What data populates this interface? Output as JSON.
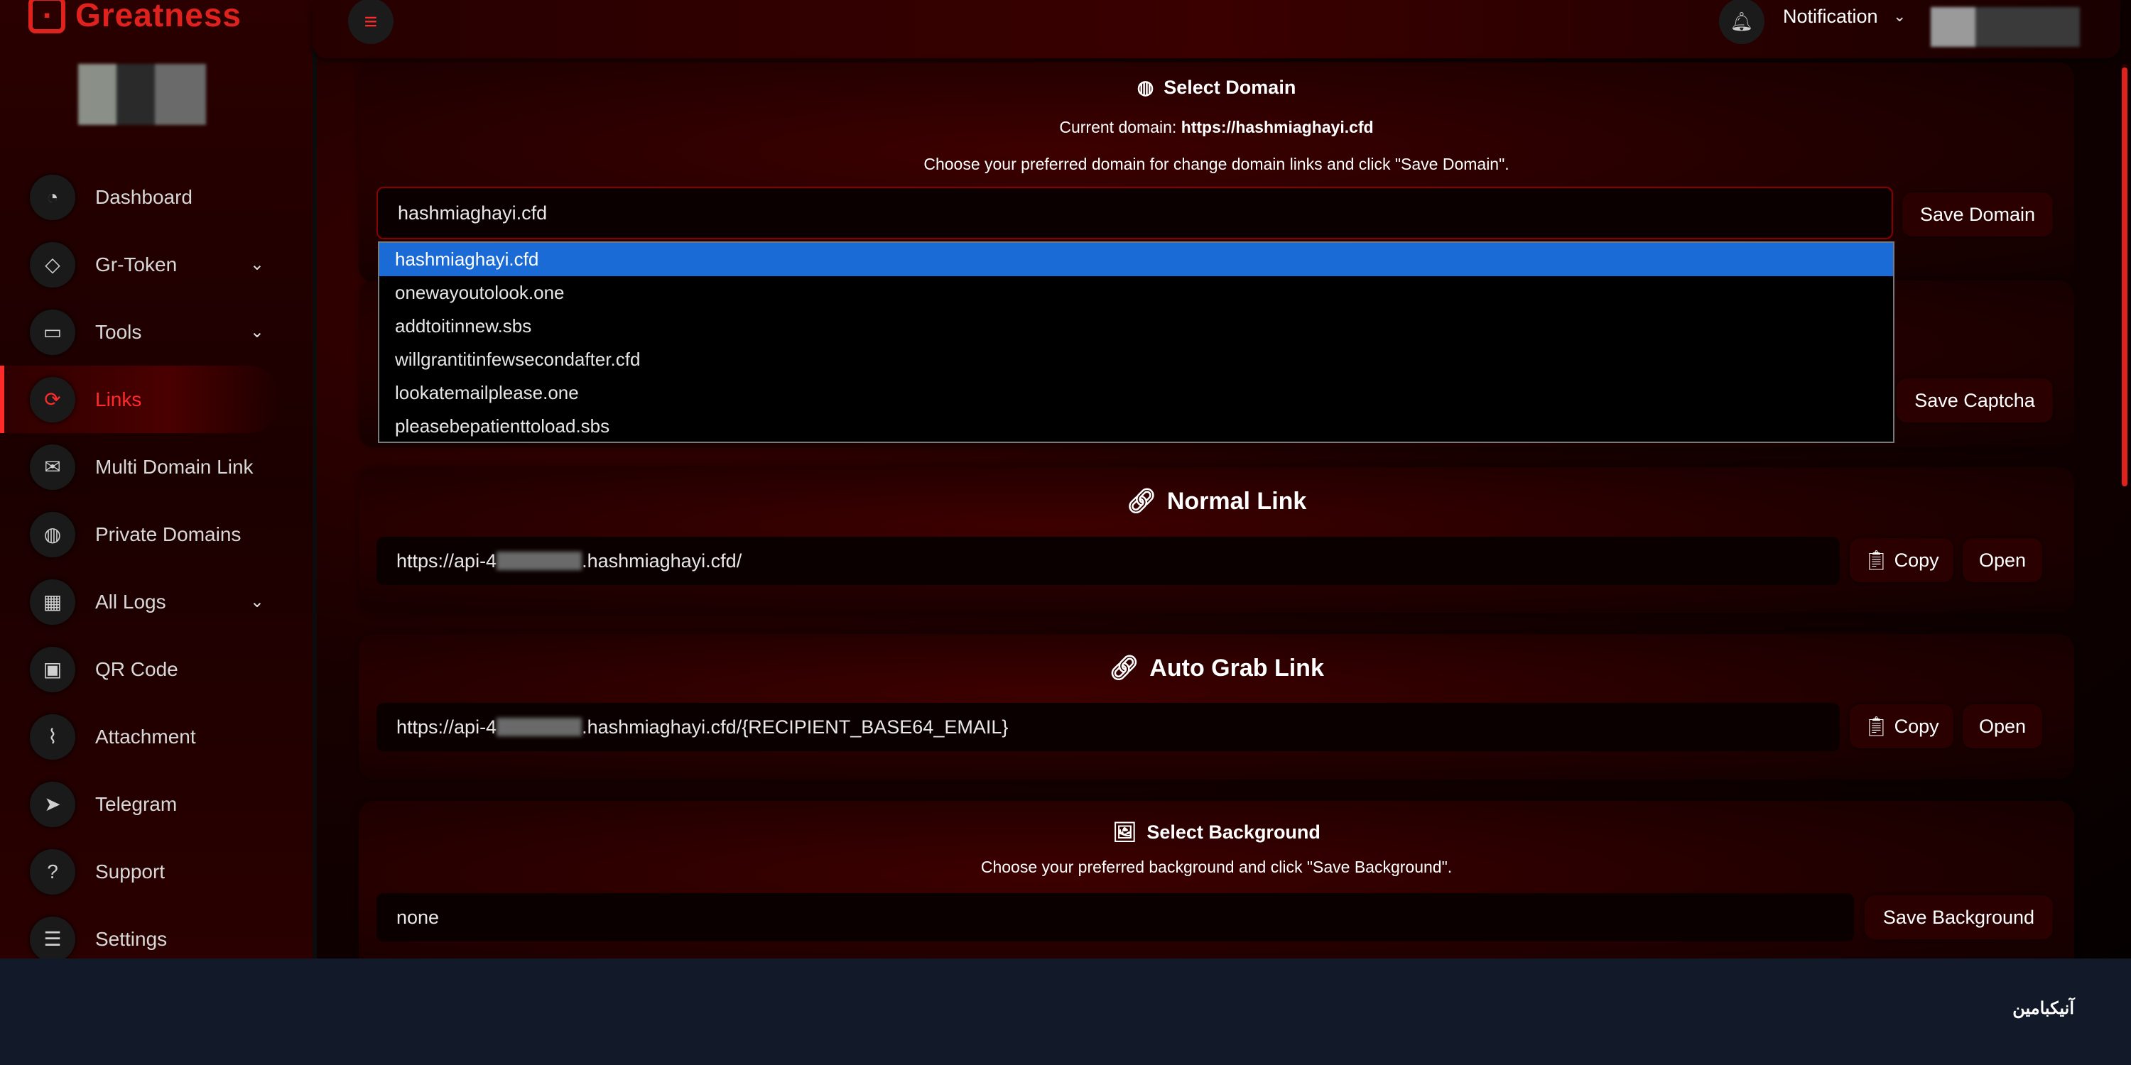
{
  "app": {
    "logo_text": "Greatness"
  },
  "sidebar": {
    "items": [
      {
        "label": "Dashboard",
        "icon": "gauge-icon",
        "glyph": "◔"
      },
      {
        "label": "Gr-Token",
        "icon": "diamond-icon",
        "glyph": "◇",
        "has_chevron": true
      },
      {
        "label": "Tools",
        "icon": "laptop-icon",
        "glyph": "▭",
        "has_chevron": true
      },
      {
        "label": "Links",
        "icon": "link-icon",
        "glyph": "⟳",
        "active": true
      },
      {
        "label": "Multi Domain Link",
        "icon": "envelope-icon",
        "glyph": "✉"
      },
      {
        "label": "Private Domains",
        "icon": "globe-icon",
        "glyph": "◍"
      },
      {
        "label": "All Logs",
        "icon": "grid-icon",
        "glyph": "▦",
        "has_chevron": true
      },
      {
        "label": "QR Code",
        "icon": "qr-icon",
        "glyph": "▣"
      },
      {
        "label": "Attachment",
        "icon": "paperclip-icon",
        "glyph": "⌇"
      },
      {
        "label": "Telegram",
        "icon": "telegram-icon",
        "glyph": "➤"
      },
      {
        "label": "Support",
        "icon": "question-icon",
        "glyph": "?"
      },
      {
        "label": "Settings",
        "icon": "sliders-icon",
        "glyph": "☰"
      }
    ]
  },
  "topbar": {
    "notification_label": "Notification"
  },
  "select_domain": {
    "title": "Select Domain",
    "current_label": "Current domain: ",
    "current_value": "https://hashmiaghayi.cfd",
    "instructions": "Choose your preferred domain for change domain links and click \"Save Domain\".",
    "selected": "hashmiaghayi.cfd",
    "save_label": "Save Domain",
    "options": [
      "hashmiaghayi.cfd",
      "onewayoutolook.one",
      "addtoitinnew.sbs",
      "willgrantitinfewsecondafter.cfd",
      "lookatemailplease.one",
      "pleasebepatienttoload.sbs"
    ]
  },
  "captcha": {
    "save_label": "Save Captcha"
  },
  "normal_link": {
    "title": "Normal Link",
    "url_prefix": "https://api-4",
    "url_suffix": ".hashmiaghayi.cfd/",
    "copy_label": "Copy",
    "open_label": "Open"
  },
  "auto_grab_link": {
    "title": "Auto Grab Link",
    "url_prefix": "https://api-4",
    "url_suffix": ".hashmiaghayi.cfd/{RECIPIENT_BASE64_EMAIL}",
    "copy_label": "Copy",
    "open_label": "Open"
  },
  "select_background": {
    "title": "Select Background",
    "instructions": "Choose your preferred background and click \"Save Background\".",
    "selected": "none",
    "save_label": "Save Background"
  },
  "footer": {
    "brand_text": "آنیکبامین"
  },
  "colors": {
    "accent": "#e0221f",
    "selected_option": "#1b6bd6",
    "footer": "#121a29"
  }
}
